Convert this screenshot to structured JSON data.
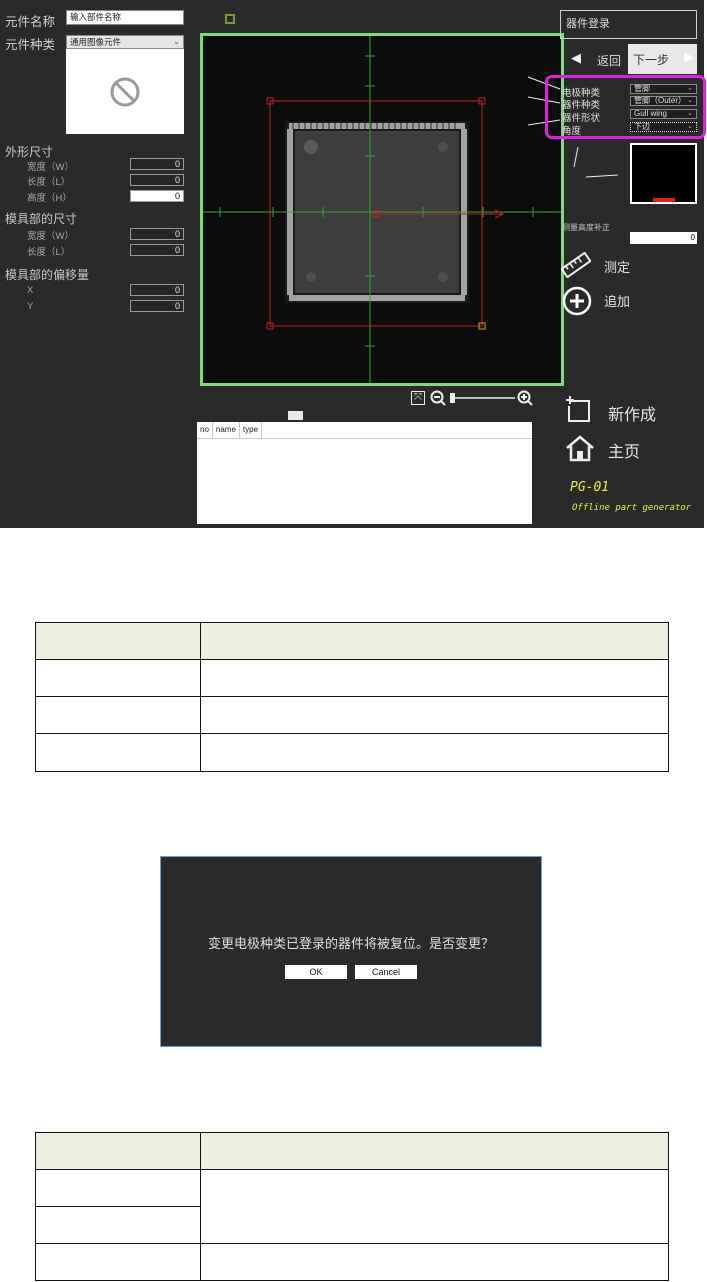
{
  "left_panel": {
    "part_name_label": "元件名称",
    "part_name_value": "输入部件名称",
    "part_type_label": "元件种类",
    "part_type_value": "通用图像元件",
    "outer_size_label": "外形尺寸",
    "width_label": "宽度（W）",
    "length_label": "长度（L）",
    "height_label": "高度（H）",
    "width_value": "0",
    "length_value": "0",
    "height_value": "0",
    "mold_size_label": "模具部的尺寸",
    "mold_width_label": "宽度（W）",
    "mold_length_label": "长度（L）",
    "mold_width_value": "0",
    "mold_length_value": "0",
    "mold_offset_label": "模具部的偏移量",
    "x_label": "X",
    "y_label": "Y",
    "x_value": "0",
    "y_value": "0"
  },
  "element_table": {
    "headers": [
      "no",
      "name",
      "type"
    ]
  },
  "right_panel": {
    "register_label": "器件登录",
    "back_label": "返回",
    "next_label": "下一步",
    "electrode_type_label": "电极种类",
    "electrode_type_value": "管脚",
    "device_type_label": "器件种类",
    "device_type_value": "管脚（Outer）",
    "device_shape_label": "器件形状",
    "device_shape_value": "Gull wing",
    "angle_label": "角度",
    "angle_value": "下边",
    "height_correction_label": "测量高度补正",
    "height_correction_value": "0",
    "measure_label": "测定",
    "add_label": "追加",
    "new_label": "新作成",
    "home_label": "主页",
    "app_code": "PG-01",
    "app_name": "Offline part generator"
  },
  "dialog": {
    "message": "变更电极种类已登录的器件将被复位。是否变更？",
    "ok_label": "OK",
    "cancel_label": "Cancel"
  },
  "colors": {
    "app_bg": "#2a2a2a",
    "frame_green": "#7ddc7a",
    "highlight_magenta": "#e020e0",
    "crosshair_green": "#2fa82f",
    "roi_red": "#c02020",
    "logo_yellow": "#e8f040",
    "table_header_bg": "#ebf1de"
  }
}
